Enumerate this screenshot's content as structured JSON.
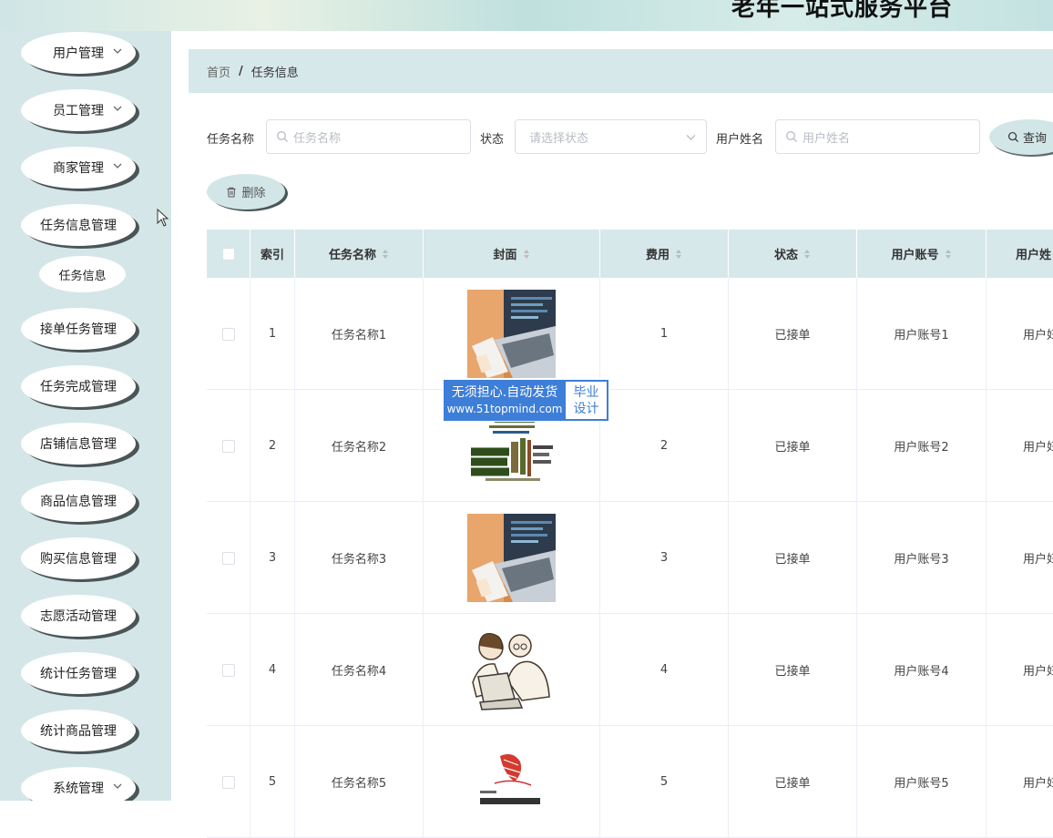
{
  "header": {
    "title": "老年一站式服务平台"
  },
  "sidebar": {
    "items": [
      {
        "label": "用户管理",
        "has_arrow": true
      },
      {
        "label": "员工管理",
        "has_arrow": true
      },
      {
        "label": "商家管理",
        "has_arrow": true
      },
      {
        "label": "任务信息管理",
        "has_arrow": false
      },
      {
        "label": "接单任务管理",
        "has_arrow": false
      },
      {
        "label": "任务完成管理",
        "has_arrow": false
      },
      {
        "label": "店铺信息管理",
        "has_arrow": false
      },
      {
        "label": "商品信息管理",
        "has_arrow": false
      },
      {
        "label": "购买信息管理",
        "has_arrow": false
      },
      {
        "label": "志愿活动管理",
        "has_arrow": false
      },
      {
        "label": "统计任务管理",
        "has_arrow": false
      },
      {
        "label": "统计商品管理",
        "has_arrow": false
      },
      {
        "label": "系统管理",
        "has_arrow": true
      }
    ],
    "active_sub": "任务信息"
  },
  "breadcrumb": {
    "home": "首页",
    "separator": "/",
    "current": "任务信息"
  },
  "search": {
    "task_name_label": "任务名称",
    "task_name_placeholder": "任务名称",
    "status_label": "状态",
    "status_placeholder": "请选择状态",
    "user_name_label": "用户姓名",
    "user_name_placeholder": "用户姓名",
    "query_label": "查询"
  },
  "actions": {
    "delete_label": "删除"
  },
  "table": {
    "columns": {
      "index": "索引",
      "task_name": "任务名称",
      "cover": "封面",
      "fee": "费用",
      "status": "状态",
      "user_account": "用户账号",
      "user_name": "用户姓"
    },
    "rows": [
      {
        "index": "1",
        "task_name": "任务名称1",
        "cover": "laptop-photo",
        "fee": "1",
        "status": "已接单",
        "user_account": "用户账号1",
        "user_name": "用户妇"
      },
      {
        "index": "2",
        "task_name": "任务名称2",
        "cover": "java-wordcloud",
        "fee": "2",
        "status": "已接单",
        "user_account": "用户账号2",
        "user_name": "用户妇"
      },
      {
        "index": "3",
        "task_name": "任务名称3",
        "cover": "laptop-photo",
        "fee": "3",
        "status": "已接单",
        "user_account": "用户账号3",
        "user_name": "用户妇"
      },
      {
        "index": "4",
        "task_name": "任务名称4",
        "cover": "coders-sketch",
        "fee": "4",
        "status": "已接单",
        "user_account": "用户账号4",
        "user_name": "用户妇"
      },
      {
        "index": "5",
        "task_name": "任务名称5",
        "cover": "sqlserver-logo",
        "fee": "5",
        "status": "已接单",
        "user_account": "用户账号5",
        "user_name": "用户妇"
      }
    ]
  },
  "watermark": {
    "line1": "无须担心.自动发货",
    "line2": "www.51topmind.com",
    "right_top": "毕业",
    "right_bottom": "设计"
  },
  "colors": {
    "sidebar_bg": "#d4e6e8",
    "header_bg": "#d7e8ea",
    "watermark_blue": "#3d7ed8"
  }
}
